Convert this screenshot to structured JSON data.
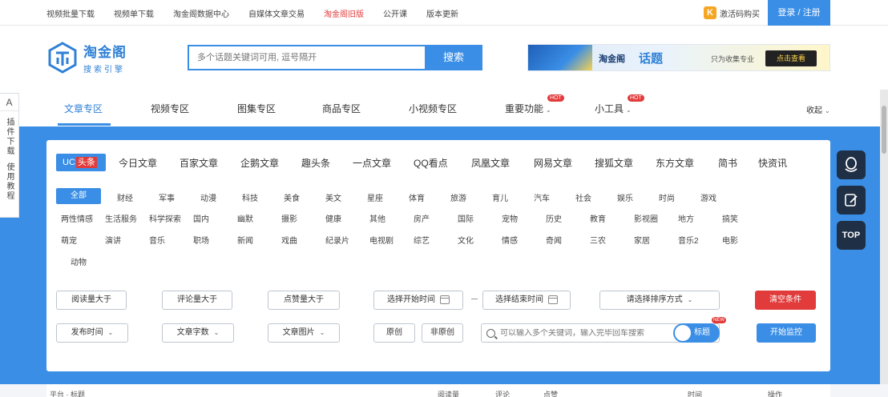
{
  "topbar": {
    "links": [
      "视频批量下载",
      "视频单下载",
      "淘金阁数据中心",
      "自媒体文章交易",
      "淘金阁旧版",
      "公开课",
      "版本更新"
    ],
    "highlight_index": 4,
    "promo_label": "激活码购买",
    "login_label": "登录 / 注册"
  },
  "logo": {
    "title": "淘金阁",
    "subtitle": "搜索引擎"
  },
  "search": {
    "placeholder": "多个话题关键词可用, 逗号隔开",
    "button": "搜索"
  },
  "banner": {
    "brand": "淘金阁",
    "topic": "话题",
    "note": "只为收集专业",
    "cta": "点击查看"
  },
  "nav": {
    "items": [
      "文章专区",
      "视频专区",
      "图集专区",
      "商品专区",
      "小视频专区",
      "重要功能",
      "小工具"
    ],
    "active_index": 0,
    "collapse": "收起"
  },
  "platforms": {
    "uc_label": "UC",
    "uc_highlight": "头条",
    "items": [
      "今日文章",
      "百家文章",
      "企鹅文章",
      "趣头条",
      "一点文章",
      "QQ看点",
      "凤凰文章",
      "网易文章",
      "搜狐文章",
      "东方文章",
      "简书",
      "快资讯"
    ]
  },
  "categories": {
    "all": "全部",
    "row1": [
      "财经",
      "军事",
      "动漫",
      "科技",
      "美食",
      "美文",
      "星座",
      "体育",
      "旅游",
      "育儿",
      "汽车",
      "社会",
      "娱乐",
      "时尚",
      "游戏"
    ],
    "row2": [
      "两性情感",
      "生活服务",
      "科学探索",
      "国内",
      "幽默",
      "摄影",
      "健康",
      "其他",
      "房产",
      "国际",
      "宠物",
      "历史",
      "教育",
      "影视圈",
      "地方",
      "搞笑"
    ],
    "row3": [
      "萌宠",
      "演讲",
      "音乐",
      "职场",
      "新闻",
      "戏曲",
      "纪录片",
      "电视剧",
      "综艺",
      "文化",
      "情感",
      "奇闻",
      "三农",
      "家居",
      "音乐2",
      "电影"
    ],
    "row4": [
      "动物"
    ]
  },
  "filters": {
    "read_gt": "阅读量大于",
    "comment_gt": "评论量大于",
    "like_gt": "点赞量大于",
    "start_time": "选择开始时间",
    "end_time": "选择结束时间",
    "sort": "请选择排序方式",
    "clear": "清空条件",
    "publish_time": "发布时间",
    "word_count": "文章字数",
    "article_image": "文章图片",
    "original": "原创",
    "non_original": "非原创",
    "keyword_placeholder": "可以输入多个关键词，输入完毕回车搜索",
    "toggle_label": "标题",
    "start": "开始监控"
  },
  "left_widget": {
    "letter": "A",
    "v1": "插件下载",
    "v2": "使用教程"
  },
  "right_float": {
    "top_label": "TOP"
  },
  "bottom": [
    "平台 · 标题",
    "阅读量",
    "评论",
    "点赞",
    "时间",
    "操作"
  ],
  "colors": {
    "accent": "#3a8ee6",
    "danger": "#e23b3b",
    "dark": "#1f2f45"
  }
}
